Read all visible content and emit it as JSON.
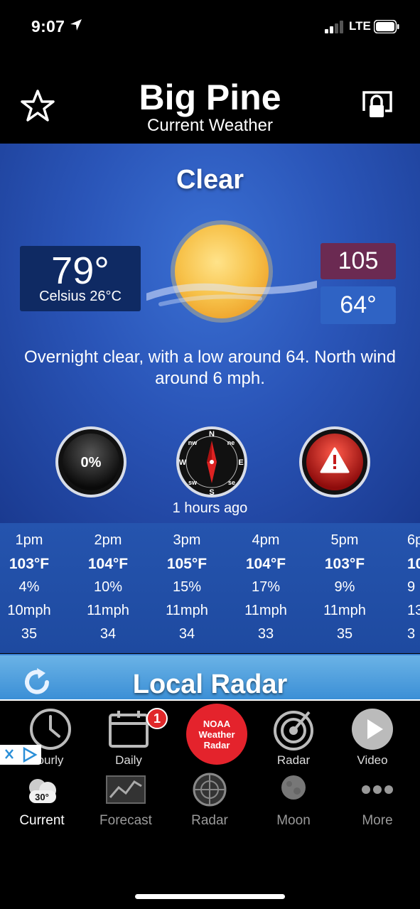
{
  "status": {
    "time": "9:07",
    "network": "LTE"
  },
  "header": {
    "city": "Big Pine",
    "subtitle": "Current Weather"
  },
  "current": {
    "condition": "Clear",
    "temp": "79°",
    "celsius": "Celsius 26°C",
    "high": "105",
    "low": "64°",
    "description": "Overnight clear, with a low around 64. North wind around 6 mph.",
    "precip": "0%",
    "updated": "1 hours ago",
    "compass": {
      "n": "N",
      "ne": "ne",
      "e": "E",
      "se": "se",
      "s": "S",
      "sw": "sw",
      "w": "W",
      "nw": "nw"
    }
  },
  "hourly": [
    {
      "time": "1pm",
      "temp": "103°F",
      "precip": "4%",
      "wind": "10mph",
      "other": "35"
    },
    {
      "time": "2pm",
      "temp": "104°F",
      "precip": "10%",
      "wind": "11mph",
      "other": "34"
    },
    {
      "time": "3pm",
      "temp": "105°F",
      "precip": "15%",
      "wind": "11mph",
      "other": "34"
    },
    {
      "time": "4pm",
      "temp": "104°F",
      "precip": "17%",
      "wind": "11mph",
      "other": "33"
    },
    {
      "time": "5pm",
      "temp": "103°F",
      "precip": "9%",
      "wind": "11mph",
      "other": "35"
    },
    {
      "time": "6p",
      "temp": "10",
      "precip": "9",
      "wind": "13r",
      "other": "3"
    }
  ],
  "radar_bar": {
    "title": "Local Radar"
  },
  "shortcuts": {
    "hourly": "ourly",
    "daily": "Daily",
    "daily_badge": "1",
    "noaa_line1": "NOAA",
    "noaa_line2": "Weather",
    "noaa_line3": "Radar",
    "radar": "Radar",
    "video": "Video"
  },
  "tabs": {
    "current_icon_temp": "30°",
    "current": "Current",
    "forecast": "Forecast",
    "radar": "Radar",
    "moon": "Moon",
    "more": "More"
  },
  "colors": {
    "high_bg": "#6b2a52",
    "low_bg": "#2f63c4",
    "alert": "#e0282a",
    "panel": "#2a55b8"
  }
}
